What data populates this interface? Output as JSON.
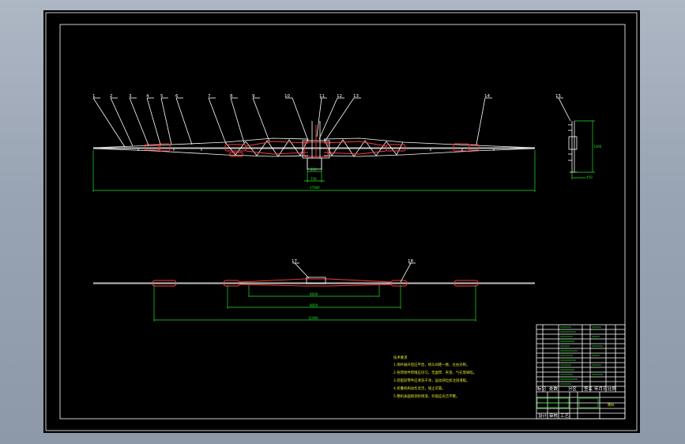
{
  "colors": {
    "background": "#000000",
    "frame": "#ffffff",
    "part": "#ffffff",
    "detail": "#ff3b3b",
    "dimension": "#25e02a",
    "note": "#e5e535"
  },
  "balloons_upper": [
    "1",
    "2",
    "3",
    "4",
    "5",
    "6",
    "7",
    "8",
    "9",
    "10",
    "11",
    "12",
    "13",
    "14"
  ],
  "balloon_side": "15",
  "balloons_lower": [
    "17",
    "18"
  ],
  "dimensions": {
    "upper_overall": "17600",
    "upper_center_1": "250",
    "upper_center_2": "750",
    "side_height": "1400",
    "side_base": "450",
    "lower_inner": "6000",
    "lower_mid": "8000",
    "lower_overall": "11600"
  },
  "notes": {
    "title": "技术要求",
    "lines": [
      "1.喷杆展开后应平直，喷头间距一致，左右对称。",
      "2.各焊接件焊缝应均匀，无虚焊、夹渣、气孔等缺陷。",
      "3.装配前零件应清洗干净，运动部位加注润滑脂。",
      "4.折叠机构动作灵活，锁止可靠。",
      "5.整机表面喷涂防锈漆，外观应光洁平整。"
    ]
  },
  "title_block": {
    "name": "喷杆",
    "footer_labels": [
      "标记",
      "处数",
      "分区",
      "签名",
      "年月日",
      "比例"
    ],
    "bottom_labels": [
      "设计",
      "审核",
      "工艺"
    ]
  }
}
